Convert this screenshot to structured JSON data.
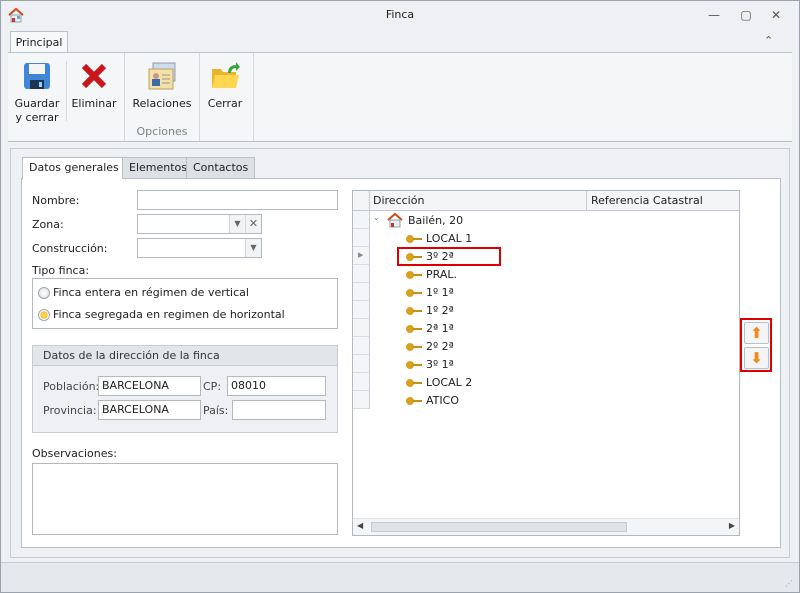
{
  "window": {
    "title": "Finca",
    "minimize": "—",
    "maximize": "▢",
    "close": "✕"
  },
  "ribbon": {
    "tab": "Principal",
    "collapse": "⌃",
    "group_label": "Opciones",
    "buttons": [
      {
        "label1": "Guardar",
        "label2": "y cerrar"
      },
      {
        "label1": "Eliminar"
      },
      {
        "label1": "Relaciones"
      },
      {
        "label1": "Cerrar"
      }
    ]
  },
  "tabs": [
    "Datos generales",
    "Elementos",
    "Contactos"
  ],
  "form": {
    "nombre_label": "Nombre:",
    "nombre": "",
    "zona_label": "Zona:",
    "zona": "",
    "construccion_label": "Construcción:",
    "construccion": "",
    "tipo_label": "Tipo finca:",
    "radio1": "Finca entera en régimen de vertical",
    "radio2": "Finca segregada en regimen de horizontal",
    "selected": 2,
    "direccion_group": "Datos de la dirección de la finca",
    "poblacion_label": "Población:",
    "poblacion": "BARCELONA",
    "cp_label": "CP:",
    "cp": "08010",
    "provincia_label": "Provincia:",
    "provincia": "BARCELONA",
    "pais_label": "País:",
    "pais": "",
    "observaciones_label": "Observaciones:",
    "observaciones": ""
  },
  "grid": {
    "columns": [
      "Dirección",
      "Referencia Catastral"
    ],
    "root": "Bailén, 20",
    "items": [
      "LOCAL 1",
      "3º 2ª",
      "PRAL.",
      "1º 1ª",
      "1º 2ª",
      "2ª 1ª",
      "2º 2ª",
      "3º 1ª",
      "LOCAL 2",
      "ATICO"
    ],
    "selected_index": 1
  },
  "colors": {
    "highlight": "#e00000",
    "accent": "#f08a1c"
  }
}
